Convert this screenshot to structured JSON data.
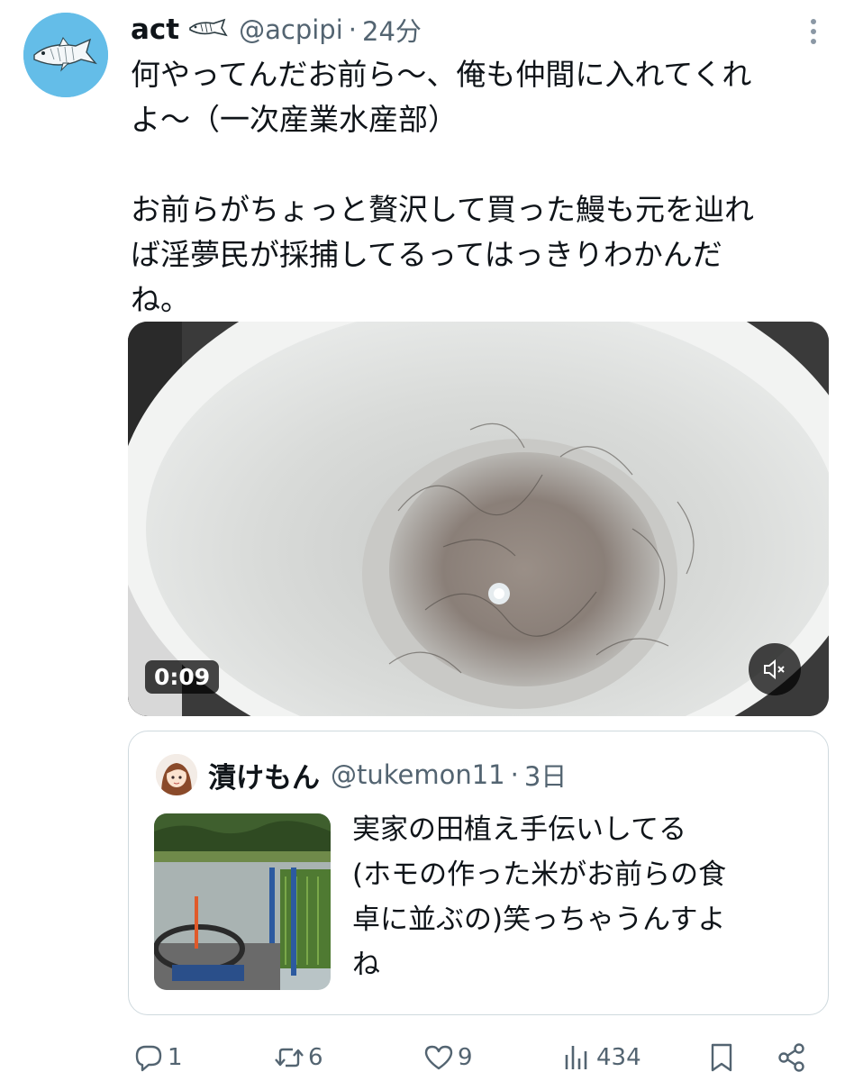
{
  "tweet": {
    "author_name": "act",
    "handle": "@acpipi",
    "separator": "·",
    "time": "24分",
    "body_lines": [
      "何やってんだお前ら〜、俺も仲間に入れてくれ",
      "よ〜（一次産業水産部）",
      "",
      "お前らがちょっと贅沢して買った鰻も元を辿れ",
      "ば淫夢民が採捕してるってはっきりわかんだ",
      "ね。"
    ],
    "video_duration": "0:09"
  },
  "quoted": {
    "author_name": "漬けもん",
    "handle": "@tukemon11",
    "separator": "·",
    "time": "3日",
    "text_lines": [
      "実家の田植え手伝いしてる",
      "(ホモの作った米がお前らの食",
      "卓に並ぶの)笑っちゃうんすよ",
      "ね"
    ]
  },
  "actions": {
    "replies": "1",
    "retweets": "6",
    "likes": "9",
    "views": "434"
  },
  "icons": {
    "more": "more-vertical-icon",
    "mute": "speaker-muted-icon",
    "reply": "reply-icon",
    "retweet": "retweet-icon",
    "like": "heart-icon",
    "views": "views-chart-icon",
    "bookmark": "bookmark-icon",
    "share": "share-icon"
  },
  "colors": {
    "text_primary": "#0f1419",
    "text_secondary": "#536471",
    "border": "#cfd9de",
    "avatar_bg": "#64bde8"
  }
}
